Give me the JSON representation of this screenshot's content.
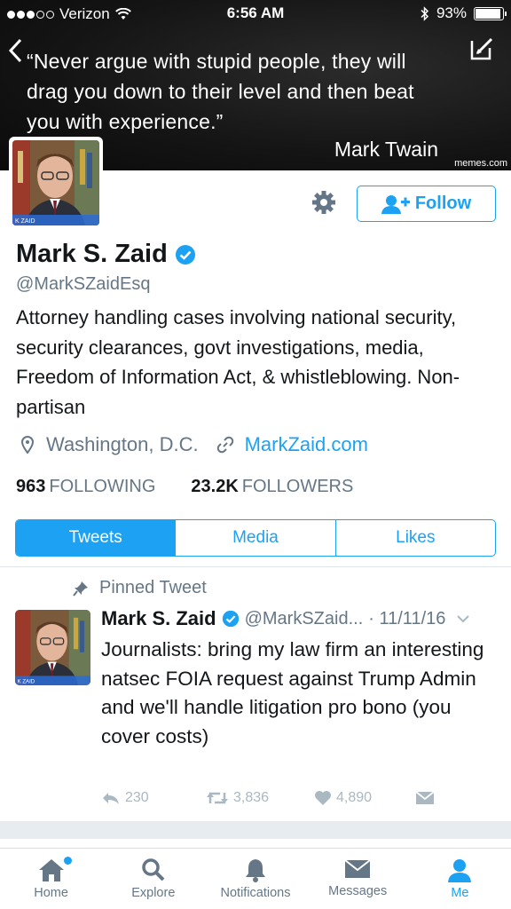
{
  "status_bar": {
    "carrier": "Verizon",
    "time": "6:56 AM",
    "battery": "93%",
    "battery_level": 0.93
  },
  "banner": {
    "quote": "“Never argue with stupid people, they will drag you down to their level and then beat you with experience.”",
    "author": "Mark Twain",
    "watermark": "memes.com"
  },
  "avatar": {
    "caption": "K ZAID"
  },
  "profile": {
    "follow_label": "Follow",
    "name": "Mark S. Zaid",
    "handle": "@MarkSZaidEsq",
    "bio": "Attorney handling cases involving national security, security clearances, govt investigations, media, Freedom of Information Act, & whistleblowing. Non-partisan",
    "location": "Washington, D.C.",
    "website": "MarkZaid.com",
    "following_count": "963",
    "following_label": "FOLLOWING",
    "followers_count": "23.2K",
    "followers_label": "FOLLOWERS"
  },
  "tabs": [
    {
      "label": "Tweets",
      "active": true
    },
    {
      "label": "Media",
      "active": false
    },
    {
      "label": "Likes",
      "active": false
    }
  ],
  "tweet": {
    "pinned_label": "Pinned Tweet",
    "name": "Mark S. Zaid",
    "handle": "@MarkSZaid...",
    "date": "· 11/11/16",
    "text": "Journalists: bring my law firm an interesting natsec FOIA request against Trump Admin and we'll handle litigation pro bono (you cover costs)",
    "replies": "230",
    "retweets": "3,836",
    "likes": "4,890"
  },
  "nav": {
    "home": "Home",
    "explore": "Explore",
    "notifications": "Notifications",
    "messages": "Messages",
    "me": "Me"
  },
  "colors": {
    "accent": "#1da1f2",
    "secondary_text": "#657786",
    "action_gray": "#aab8c2"
  }
}
